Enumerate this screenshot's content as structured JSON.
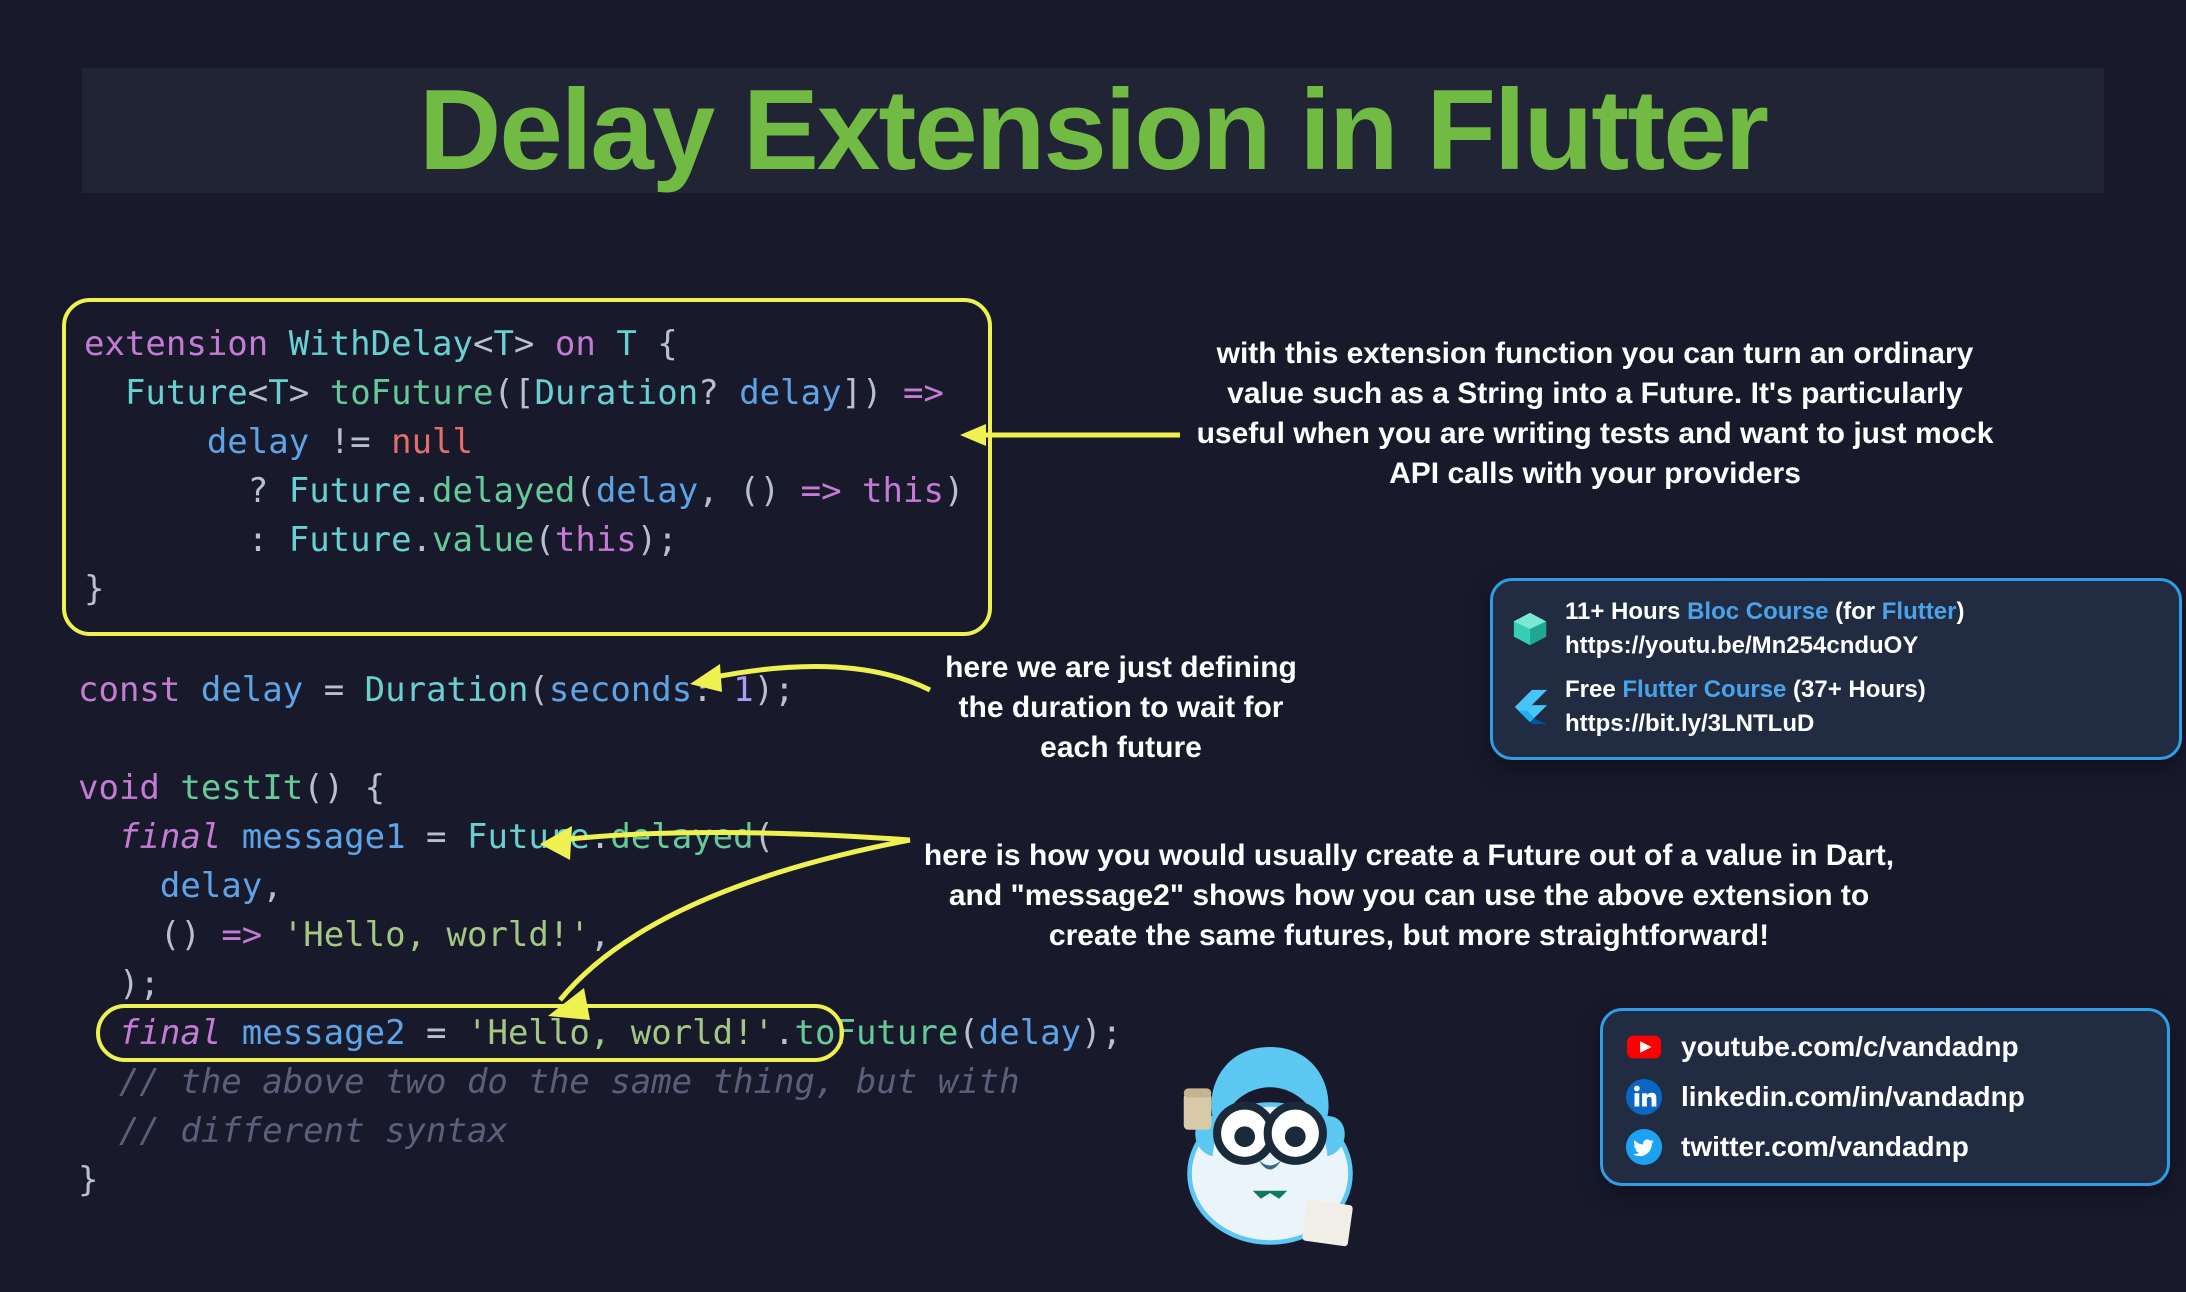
{
  "title": "Delay Extension in Flutter",
  "annotations": {
    "top": "with this extension function you can turn an ordinary value such as a String into a Future. It's particularly useful when you are writing tests and want to just mock API calls with your providers",
    "mid": "here we are just defining the duration to wait for each future",
    "bottom": "here is how you would usually create a Future out of a value in Dart, and \"message2\" shows how you can use the above extension to create the same futures, but more straightforward!"
  },
  "code1": {
    "ext": "extension",
    "name": "WithDelay",
    "t": "T",
    "on": "on",
    "brace_o": "{",
    "fut": "Future",
    "tof": "toFuture",
    "paren_o": "(",
    "brack_o": "[",
    "dur": "Duration",
    "q": "?",
    "delay": "delay",
    "brack_c": "]",
    "paren_c": ")",
    "arrow": "=>",
    "neq": "!=",
    "null": "null",
    "qm": "?",
    "dot": ".",
    "delayed": "delayed",
    "lp": "(",
    "comma": ",",
    "lam_o": "()",
    "lam_a": "=>",
    "this": "this",
    "rp": ")",
    "col": ":",
    "value": "value",
    "semi": ";",
    "brace_c": "}"
  },
  "code2": {
    "const": "const",
    "dvar": "delay",
    "eq": "=",
    "dur": "Duration",
    "secs": "seconds",
    "col": ":",
    "one": "1",
    "semi": ";",
    "void": "void",
    "testit": "testIt",
    "pp": "()",
    "bo": "{",
    "final": "final",
    "m1": "message1",
    "fut": "Future",
    "delayed": "delayed",
    "lp": "(",
    "arg_delay": "delay",
    "comma": ",",
    "lam": "()",
    "lam_a": "=>",
    "str": "'Hello, world!'",
    "rp": ")",
    "sc": ";",
    "m2": "message2",
    "tof": "toFuture",
    "cmt1": "// the above two do the same thing, but with",
    "cmt2": "// different syntax",
    "bc": "}"
  },
  "courses": {
    "bloc_pre": "11+ Hours ",
    "bloc_link": "Bloc Course",
    "bloc_post": " (for ",
    "bloc_flutter": "Flutter",
    "bloc_close": ")",
    "bloc_url": "https://youtu.be/Mn254cnduOY",
    "free_pre": "Free ",
    "free_link": "Flutter Course",
    "free_post": " (37+ Hours)",
    "free_url": "https://bit.ly/3LNTLuD"
  },
  "social": {
    "youtube": "youtube.com/c/vandadnp",
    "linkedin": "linkedin.com/in/vandadnp",
    "twitter": "twitter.com/vandadnp"
  }
}
